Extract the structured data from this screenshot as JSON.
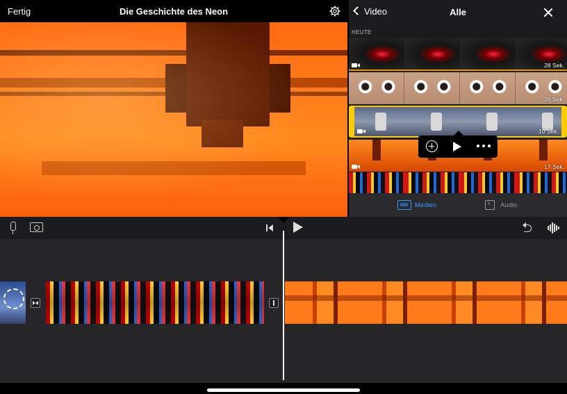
{
  "header": {
    "done_label": "Fertig",
    "project_title": "Die Geschichte des Neon",
    "settings_icon": "gear-icon"
  },
  "browser": {
    "back_label": "Video",
    "title": "Alle",
    "section_label": "HEUTE",
    "clips": [
      {
        "name": "laser-clip",
        "duration": "28 Sek."
      },
      {
        "name": "eyes-clip",
        "duration": "26 Sek."
      },
      {
        "name": "machine-clip",
        "duration": "10 Sek."
      },
      {
        "name": "orange-clip",
        "duration": "17 Sek."
      },
      {
        "name": "neon-clip",
        "duration": ""
      }
    ],
    "tabs": {
      "media": "Medien",
      "audio": "Audio"
    },
    "accent_color": "#2e9bff",
    "selection_color": "#ffcc00"
  },
  "popover": {
    "actions": [
      "add-icon",
      "play-icon",
      "more-icon"
    ]
  },
  "toolbar": {
    "icons": [
      "microphone-icon",
      "camera-icon",
      "skip-to-start-icon",
      "play-icon",
      "undo-icon",
      "audio-waveform-icon"
    ]
  }
}
